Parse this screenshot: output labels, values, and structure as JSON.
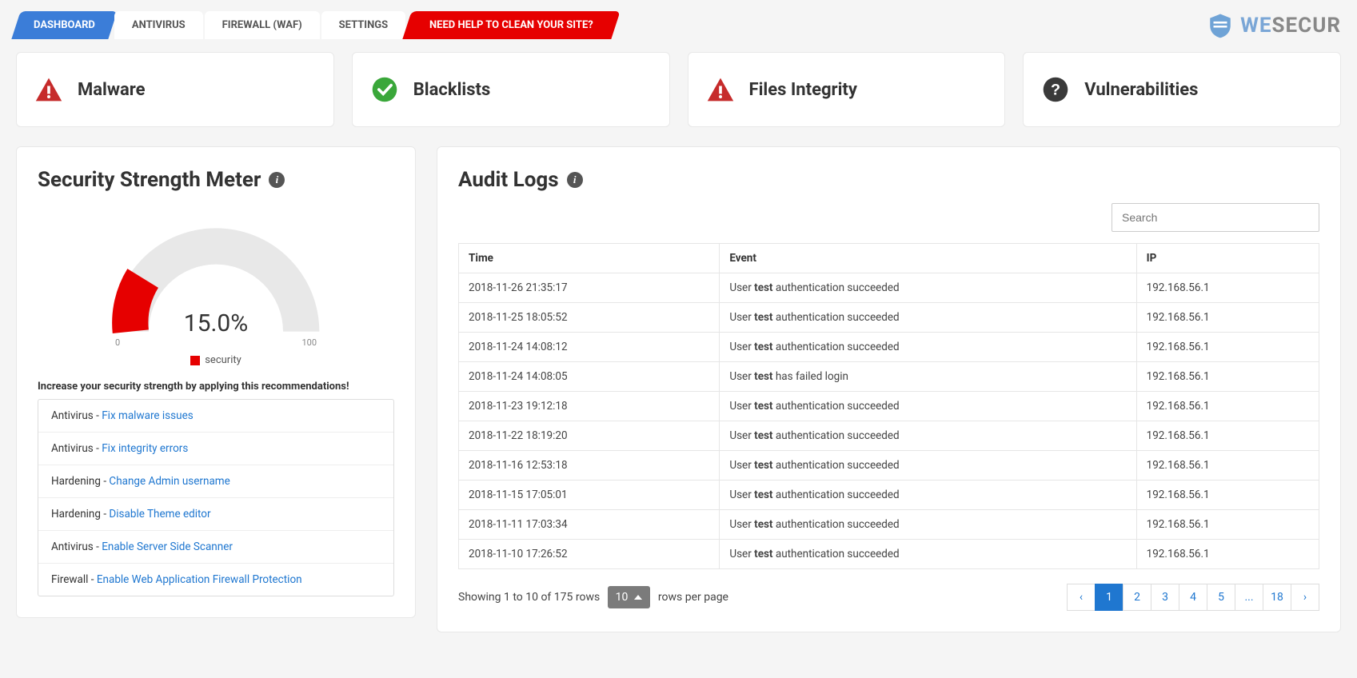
{
  "tabs": {
    "dashboard": "DASHBOARD",
    "antivirus": "ANTIVIRUS",
    "firewall": "FIREWALL (WAF)",
    "settings": "SETTINGS",
    "help": "NEED HELP TO CLEAN YOUR SITE?"
  },
  "brand": {
    "part1": "WE",
    "part2": "SECUR"
  },
  "status": {
    "malware": "Malware",
    "blacklists": "Blacklists",
    "integrity": "Files Integrity",
    "vulnerabilities": "Vulnerabilities"
  },
  "meter": {
    "title": "Security Strength Meter",
    "value_label": "15.0%",
    "tick_min": "0",
    "tick_max": "100",
    "legend": "security",
    "rec_heading": "Increase your security strength by applying this recommendations!",
    "recs": [
      {
        "cat": "Antivirus",
        "link": "Fix malware issues"
      },
      {
        "cat": "Antivirus",
        "link": "Fix integrity errors"
      },
      {
        "cat": "Hardening",
        "link": "Change Admin username"
      },
      {
        "cat": "Hardening",
        "link": "Disable Theme editor"
      },
      {
        "cat": "Antivirus",
        "link": "Enable Server Side Scanner"
      },
      {
        "cat": "Firewall",
        "link": "Enable Web Application Firewall Protection"
      }
    ]
  },
  "audit": {
    "title": "Audit Logs",
    "search_placeholder": "Search",
    "cols": {
      "time": "Time",
      "event": "Event",
      "ip": "IP"
    },
    "rows": [
      {
        "time": "2018-11-26 21:35:17",
        "prefix": "User ",
        "user": "test",
        "suffix": " authentication succeeded",
        "ip": "192.168.56.1"
      },
      {
        "time": "2018-11-25 18:05:52",
        "prefix": "User ",
        "user": "test",
        "suffix": " authentication succeeded",
        "ip": "192.168.56.1"
      },
      {
        "time": "2018-11-24 14:08:12",
        "prefix": "User ",
        "user": "test",
        "suffix": " authentication succeeded",
        "ip": "192.168.56.1"
      },
      {
        "time": "2018-11-24 14:08:05",
        "prefix": "User ",
        "user": "test",
        "suffix": " has failed login",
        "ip": "192.168.56.1"
      },
      {
        "time": "2018-11-23 19:12:18",
        "prefix": "User ",
        "user": "test",
        "suffix": " authentication succeeded",
        "ip": "192.168.56.1"
      },
      {
        "time": "2018-11-22 18:19:20",
        "prefix": "User ",
        "user": "test",
        "suffix": " authentication succeeded",
        "ip": "192.168.56.1"
      },
      {
        "time": "2018-11-16 12:53:18",
        "prefix": "User ",
        "user": "test",
        "suffix": " authentication succeeded",
        "ip": "192.168.56.1"
      },
      {
        "time": "2018-11-15 17:05:01",
        "prefix": "User ",
        "user": "test",
        "suffix": " authentication succeeded",
        "ip": "192.168.56.1"
      },
      {
        "time": "2018-11-11 17:03:34",
        "prefix": "User ",
        "user": "test",
        "suffix": " authentication succeeded",
        "ip": "192.168.56.1"
      },
      {
        "time": "2018-11-10 17:26:52",
        "prefix": "User ",
        "user": "test",
        "suffix": " authentication succeeded",
        "ip": "192.168.56.1"
      }
    ],
    "showing": "Showing 1 to 10 of 175 rows",
    "rows_per": "10",
    "rows_per_suffix": "rows per page",
    "pages": {
      "prev": "‹",
      "p1": "1",
      "p2": "2",
      "p3": "3",
      "p4": "4",
      "p5": "5",
      "ell": "...",
      "last": "18",
      "next": "›"
    }
  },
  "chart_data": {
    "type": "gauge",
    "title": "Security Strength Meter",
    "value": 15.0,
    "min": 0,
    "max": 100,
    "unit": "%",
    "series": [
      {
        "name": "security",
        "color": "#e60000"
      }
    ]
  }
}
